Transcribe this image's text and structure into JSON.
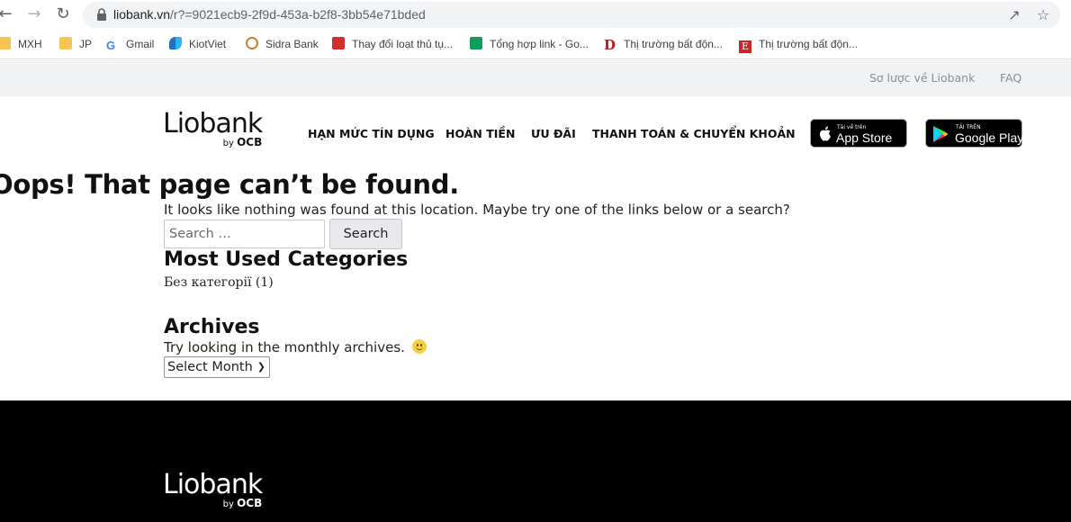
{
  "browser": {
    "url_host": "liobank.vn",
    "url_path": "/r?=9021ecb9-2f9d-453a-b2f8-3bb54e71bded",
    "bookmarks": [
      {
        "label": "MXH",
        "icon": "folder-icon"
      },
      {
        "label": "JP",
        "icon": "folder-icon"
      },
      {
        "label": "Gmail",
        "icon": "google-icon"
      },
      {
        "label": "KiotViet",
        "icon": "kiotviet-icon"
      },
      {
        "label": "Sidra Bank",
        "icon": "sidra-icon"
      },
      {
        "label": "Thay đổi loạt thủ tụ...",
        "icon": "red-arrow-icon"
      },
      {
        "label": "Tổng hợp link - Go...",
        "icon": "sheets-icon"
      },
      {
        "label": "Thị trường bất độn...",
        "icon": "d-logo-icon"
      },
      {
        "label": "Thị trường bất độn...",
        "icon": "e-logo-icon"
      }
    ]
  },
  "topbar": {
    "about": "Sơ lược về Liobank",
    "faq": "FAQ"
  },
  "header": {
    "logo": "Liobank",
    "logo_by": "by",
    "logo_ocb": "OCB",
    "menu": [
      "HẠN MỨC TÍN DỤNG",
      "HOÀN TIỀN",
      "ƯU ĐÃI",
      "THANH TOÁN & CHUYỂN KHOẢN"
    ],
    "appstore_small": "Tải về trên",
    "appstore_big": "App Store",
    "googleplay_small": "TẢI TRÊN",
    "googleplay_big": "Google Play"
  },
  "main": {
    "title": "Oops! That page can’t be found.",
    "message": "It looks like nothing was found at this location. Maybe try one of the links below or a search?",
    "search_placeholder": "Search …",
    "search_button": "Search",
    "categories_title": "Most Used Categories",
    "category_item": "Без категорії",
    "category_count": "(1)",
    "archives_title": "Archives",
    "archives_text": "Try looking in the monthly archives.",
    "select_month": "Select Month"
  },
  "footer": {
    "logo": "Liobank",
    "logo_by": "by",
    "logo_ocb": "OCB"
  },
  "colors": {
    "topstrip": "#f0f2f4",
    "footer": "#000000",
    "omnibox": "#f1f3f4"
  }
}
